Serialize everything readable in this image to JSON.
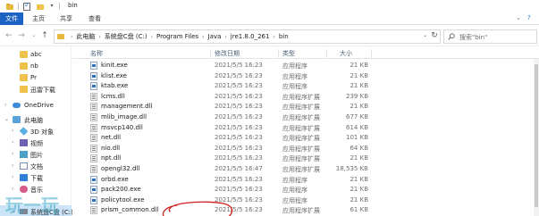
{
  "window": {
    "title": "bin"
  },
  "ribbon": {
    "file_tab": "文件",
    "tabs": [
      "主页",
      "共享",
      "查看"
    ]
  },
  "address": {
    "crumbs": [
      "此电脑",
      "系统盘C盘 (C:)",
      "Program Files",
      "Java",
      "jre1.8.0_261",
      "bin"
    ]
  },
  "search": {
    "placeholder": "搜索\"bin\""
  },
  "nav": {
    "items": [
      {
        "label": "abc",
        "icon": "folder-icon"
      },
      {
        "label": "nb",
        "icon": "folder-icon"
      },
      {
        "label": "Pr",
        "icon": "folder-icon"
      },
      {
        "label": "迅雷下载",
        "icon": "folder-icon"
      },
      {
        "label": "OneDrive",
        "icon": "onedrive-icon"
      },
      {
        "label": "此电脑",
        "icon": "this-pc-icon"
      },
      {
        "label": "3D 对象",
        "icon": "3d-objects-icon"
      },
      {
        "label": "视频",
        "icon": "videos-icon"
      },
      {
        "label": "图片",
        "icon": "pictures-icon"
      },
      {
        "label": "文档",
        "icon": "documents-icon"
      },
      {
        "label": "下载",
        "icon": "downloads-icon"
      },
      {
        "label": "音乐",
        "icon": "music-icon"
      },
      {
        "label": "系统盘C盘 (C:)",
        "icon": "drive-icon"
      }
    ]
  },
  "columns": {
    "name": "名称",
    "date": "修改日期",
    "type": "类型",
    "size": "大小"
  },
  "files": [
    {
      "name": "kinit.exe",
      "date": "2021/5/5 16:23",
      "type": "应用程序",
      "size": "21 KB",
      "kind": "exe"
    },
    {
      "name": "klist.exe",
      "date": "2021/5/5 16:23",
      "type": "应用程序",
      "size": "21 KB",
      "kind": "exe"
    },
    {
      "name": "ktab.exe",
      "date": "2021/5/5 16:23",
      "type": "应用程序",
      "size": "21 KB",
      "kind": "exe"
    },
    {
      "name": "lcms.dll",
      "date": "2021/5/5 16:23",
      "type": "应用程序扩展",
      "size": "239 KB",
      "kind": "dll"
    },
    {
      "name": "management.dll",
      "date": "2021/5/5 16:23",
      "type": "应用程序扩展",
      "size": "21 KB",
      "kind": "dll"
    },
    {
      "name": "mlib_image.dll",
      "date": "2021/5/5 16:23",
      "type": "应用程序扩展",
      "size": "677 KB",
      "kind": "dll"
    },
    {
      "name": "msvcp140.dll",
      "date": "2021/5/5 16:23",
      "type": "应用程序扩展",
      "size": "614 KB",
      "kind": "dll"
    },
    {
      "name": "net.dll",
      "date": "2021/5/5 16:23",
      "type": "应用程序扩展",
      "size": "101 KB",
      "kind": "dll"
    },
    {
      "name": "nio.dll",
      "date": "2021/5/5 16:23",
      "type": "应用程序扩展",
      "size": "64 KB",
      "kind": "dll"
    },
    {
      "name": "npt.dll",
      "date": "2021/5/5 16:23",
      "type": "应用程序扩展",
      "size": "21 KB",
      "kind": "dll"
    },
    {
      "name": "opengl32.dll",
      "date": "2021/5/5 16:47",
      "type": "应用程序扩展",
      "size": "18,535 KB",
      "kind": "dll"
    },
    {
      "name": "orbd.exe",
      "date": "2021/5/5 16:23",
      "type": "应用程序",
      "size": "21 KB",
      "kind": "exe"
    },
    {
      "name": "pack200.exe",
      "date": "2021/5/5 16:23",
      "type": "应用程序",
      "size": "21 KB",
      "kind": "exe"
    },
    {
      "name": "policytool.exe",
      "date": "2021/5/5 16:23",
      "type": "应用程序",
      "size": "21 KB",
      "kind": "exe"
    },
    {
      "name": "prism_common.dll",
      "date": "2021/5/5 16:23",
      "type": "应用程序扩展",
      "size": "61 KB",
      "kind": "dll"
    }
  ],
  "watermark": {
    "text": "玩一玩"
  },
  "colors": {
    "file_tab": "#1c64c4",
    "annotation": "#d11e1e",
    "selected": "#cce4f7"
  }
}
